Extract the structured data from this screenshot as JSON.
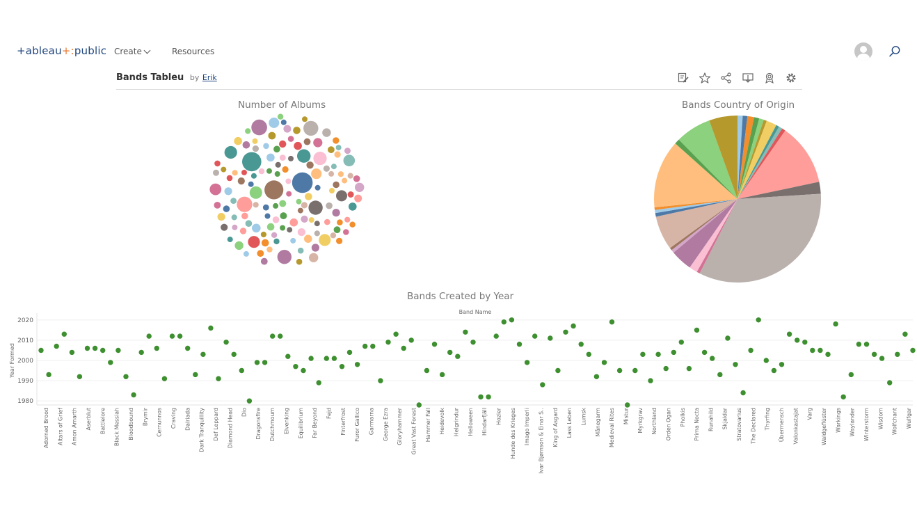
{
  "nav": {
    "logo_text": "+ableau",
    "logo_dots": "+:",
    "logo_suffix": "public",
    "create_label": "Create",
    "resources_label": "Resources"
  },
  "viz": {
    "title": "Bands Tableu",
    "by_label": "by",
    "author": "Erik"
  },
  "toolbar_icons": [
    "edit-icon",
    "favorite-star-icon",
    "share-icon",
    "download-icon",
    "badge-icon",
    "settings-gear-icon"
  ],
  "colors": {
    "brand": "#1f457e",
    "accent": "#e8762d",
    "scatter_point": "#3d8f2f"
  },
  "chart_data": [
    {
      "type": "bubble",
      "title": "Number of Albums",
      "bubble_colors": [
        "#4e79a7",
        "#a0cbe8",
        "#f28e2b",
        "#ffbe7d",
        "#59a14f",
        "#8cd17d",
        "#b6992d",
        "#f1ce63",
        "#499894",
        "#86bcb6",
        "#e15759",
        "#ff9d9a",
        "#79706e",
        "#bab0ac",
        "#d37295",
        "#fabfd2",
        "#b07aa1",
        "#d4a6c8",
        "#9d7660",
        "#d7b5a6"
      ]
    },
    {
      "type": "pie",
      "title": "Bands Country of Origin",
      "slices": [
        {
          "value": 1.0,
          "color": "#a0cbe8"
        },
        {
          "value": 0.9,
          "color": "#4e79a7"
        },
        {
          "value": 1.3,
          "color": "#f28e2b"
        },
        {
          "value": 1.0,
          "color": "#59a14f"
        },
        {
          "value": 0.9,
          "color": "#8cd17d"
        },
        {
          "value": 0.6,
          "color": "#b6992d"
        },
        {
          "value": 2.0,
          "color": "#f1ce63"
        },
        {
          "value": 0.6,
          "color": "#499894"
        },
        {
          "value": 0.7,
          "color": "#86bcb6"
        },
        {
          "value": 0.7,
          "color": "#e15759"
        },
        {
          "value": 12.0,
          "color": "#ff9d9a"
        },
        {
          "value": 2.3,
          "color": "#79706e"
        },
        {
          "value": 33.5,
          "color": "#bab0ac"
        },
        {
          "value": 0.6,
          "color": "#d37295"
        },
        {
          "value": 1.6,
          "color": "#fabfd2"
        },
        {
          "value": 4.2,
          "color": "#b07aa1"
        },
        {
          "value": 0.6,
          "color": "#d4a6c8"
        },
        {
          "value": 0.5,
          "color": "#9d7660"
        },
        {
          "value": 6.6,
          "color": "#d7b5a6"
        },
        {
          "value": 0.7,
          "color": "#4e79a7"
        },
        {
          "value": 0.6,
          "color": "#a0cbe8"
        },
        {
          "value": 0.5,
          "color": "#f28e2b"
        },
        {
          "value": 13.2,
          "color": "#ffbe7d"
        },
        {
          "value": 1.0,
          "color": "#59a14f"
        },
        {
          "value": 6.9,
          "color": "#8cd17d"
        },
        {
          "value": 5.5,
          "color": "#b6992d"
        }
      ]
    },
    {
      "type": "scatter",
      "title": "Bands Created by Year",
      "column_header": "Band Name",
      "ylabel": "Year Formed",
      "ylim": [
        1978,
        2022
      ],
      "yticks": [
        1980,
        1990,
        2000,
        2010,
        2020
      ],
      "xlabels": [
        "Adorned Brood",
        "Altars of Grief",
        "Amon Amarth",
        "Aserblut",
        "Battlelore",
        "Black Messiah",
        "Bloodbound",
        "Brymir",
        "Cernunnos",
        "Craving",
        "Dalriada",
        "Dark Tranquillity",
        "Def Leppard",
        "Diamond Head",
        "Dio",
        "Dragonsfire",
        "Dutchmoum",
        "Elvenking",
        "Equilibrium",
        "Far Beyond",
        "Fejd",
        "Finterfrost",
        "Furor Gallico",
        "Garmarna",
        "George Ezra",
        "Gloryhammer",
        "Great Vast Forest",
        "Hammer Fall",
        "Heidevolk",
        "Helgrindur",
        "Helloween",
        "Hindarfjäll",
        "Hozier",
        "Hunde des Krieges",
        "Imago Imperii",
        "Ivar Bjørnson & Einar S..",
        "King of Asgard",
        "Lass Leben",
        "Lumsk",
        "Månegarm",
        "Medieval Rites",
        "Mistur",
        "Myrkgrav",
        "Northland",
        "Orden Ogan",
        "Pholkis",
        "Prima Nocta",
        "Runahild",
        "Skjaldar",
        "Stratovarius",
        "The Declared",
        "Thyrfing",
        "Übermensch",
        "Valonkastajat",
        "Varg",
        "Waldgeflüster",
        "Warkings",
        "Waylander",
        "Winterstorm",
        "Wisdom",
        "Wolfchant",
        "Wulfgar"
      ],
      "years": [
        2005,
        1993,
        2007,
        2013,
        2004,
        1992,
        2006,
        2006,
        2005,
        1999,
        2005,
        1992,
        1983,
        2004,
        2012,
        2006,
        1991,
        2012,
        2012,
        2006,
        1993,
        2003,
        2016,
        1991,
        2009,
        2003,
        1995,
        1980,
        1999,
        1999,
        2012,
        2012,
        2002,
        1997,
        1995,
        2001,
        1989,
        2001,
        2001,
        1997,
        2004,
        1998,
        2007,
        2007,
        1990,
        2009,
        2013,
        2006,
        2010,
        1978,
        1995,
        2008,
        1993,
        2004,
        2002,
        2014,
        2009,
        1982,
        1982,
        2012,
        2019,
        2020,
        2008,
        1999,
        2012,
        1988,
        2011,
        1995,
        2014,
        2017,
        2008,
        2003,
        1992,
        1999,
        2019,
        1995,
        1978,
        1995,
        2003,
        1990,
        2003,
        1996,
        2004,
        2009,
        1996,
        2015,
        2004,
        2001,
        1993,
        2011,
        1998,
        1984,
        2005,
        2020,
        2000,
        1995,
        1998,
        2013,
        2010,
        2009,
        2005,
        2005,
        2003,
        2018,
        1982,
        1993,
        2008,
        2008,
        2003,
        2001,
        1989,
        2003,
        2013,
        2005
      ]
    }
  ]
}
